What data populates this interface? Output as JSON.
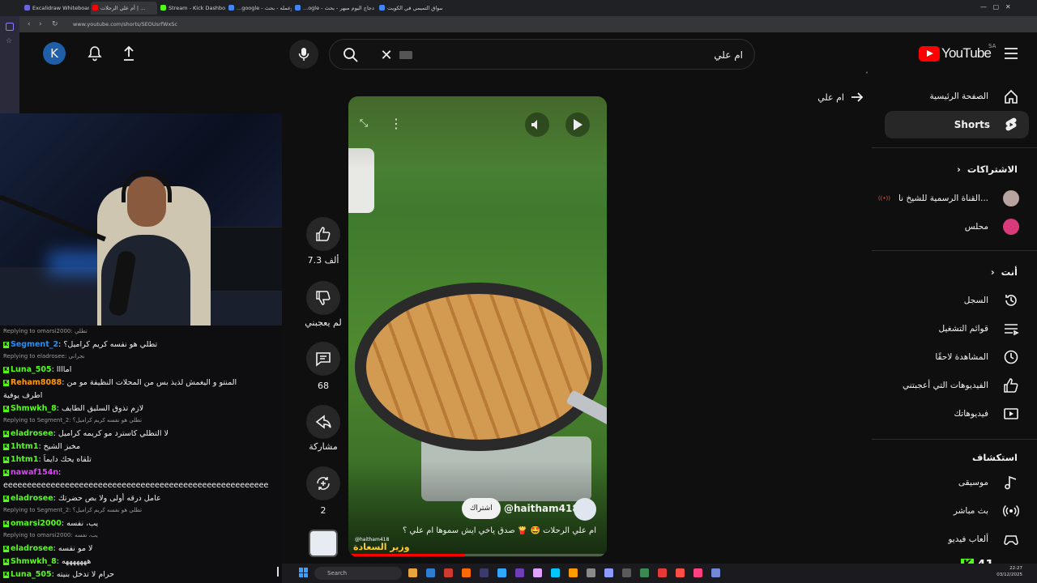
{
  "browser": {
    "tabs": [
      {
        "label": "Excalidraw Whiteboard",
        "color": "#6965db"
      },
      {
        "label": "أم علي الرحلات | ...",
        "color": "#ff0000"
      },
      {
        "label": "Stream - Kick Dashboard",
        "color": "#53fc18"
      },
      {
        "label": "...google - معلم وعمله - بحث",
        "color": "#4285f4"
      },
      {
        "label": "...ogle - دجاج اليوم مبهر - بحث",
        "color": "#4285f4"
      },
      {
        "label": "اسواق التميمي في الكويت",
        "color": "#4285f4"
      }
    ],
    "url": "www.youtube.com/shorts/SEOUsrfWxSc"
  },
  "chat": {
    "messages": [
      {
        "type": "reply",
        "text": "Replying to omarsi2000: تطلي"
      },
      {
        "type": "msg",
        "user": "Segment_2",
        "color": "#1e90ff",
        "text": "تطلي هو نفسه كريم كراميل؟"
      },
      {
        "type": "reply",
        "text": "Replying to eladrosee: نجراني"
      },
      {
        "type": "msg",
        "user": "Luna_505",
        "color": "#53fc18",
        "text": "اماااا"
      },
      {
        "type": "msg",
        "user": "Reham8088",
        "color": "#ff9800",
        "text": "المنتو و اليغمش لذيذ بس من المحلات النظيفة مو من"
      },
      {
        "type": "cont",
        "text": "اطرف يوفية"
      },
      {
        "type": "msg",
        "user": "Shmwkh_8",
        "color": "#53fc18",
        "text": "لازم تذوق السليق الطايف"
      },
      {
        "type": "reply",
        "text": "Replying to Segment_2: تطلي هو نفسه كريم كراميل؟"
      },
      {
        "type": "msg",
        "user": "eladrosee",
        "color": "#53fc18",
        "text": "لا التطلي كاسترد مو كريمه كراميل"
      },
      {
        "type": "msg",
        "user": "1htm1",
        "color": "#53fc18",
        "text": "مخبز الشيخ"
      },
      {
        "type": "msg",
        "user": "1htm1",
        "color": "#53fc18",
        "text": "تلقاه يحك دايماً"
      },
      {
        "type": "msg",
        "user": "nawaf154n",
        "color": "#e040fb",
        "text": ""
      },
      {
        "type": "cont",
        "text": "eeeeeeeeeeeeeeeeeeeeeeeeeeeeeeeeeeeeeeeeeeeeeeeeeeeeeeee"
      },
      {
        "type": "msg",
        "user": "eladrosee",
        "color": "#53fc18",
        "text": "عامل درقه أولى ولا بص حضرتك"
      },
      {
        "type": "reply",
        "text": "Replying to Segment_2: تطلي هو نفسه كريم كراميل؟"
      },
      {
        "type": "msg",
        "user": "omarsi2000",
        "color": "#53fc18",
        "text": "يب، نفسه"
      },
      {
        "type": "reply",
        "text": "Replying to omarsi2000: يب، نفسه"
      },
      {
        "type": "msg",
        "user": "eladrosee",
        "color": "#53fc18",
        "text": "لا مو نفسه"
      },
      {
        "type": "msg",
        "user": "Shmwkh_8",
        "color": "#53fc18",
        "text": "هههههههه"
      },
      {
        "type": "msg",
        "user": "Luna_505",
        "color": "#53fc18",
        "text": "حرام لا تدخل بنيته"
      }
    ]
  },
  "header": {
    "avatar_letter": "K",
    "search_value": "ام علي",
    "logo_text": "YouTube",
    "region": "SA"
  },
  "shorts": {
    "back_label": "ام علي",
    "channel": "@haitham418",
    "subscribe": "اشتراك",
    "title": "ام علي الرحلات 🤩 🍟 صدق ياخي ايش سموها ام علي ؟",
    "watermark_top": "@haitham418",
    "watermark_bottom": "وزير السعادة",
    "likes": "7.3 ألف",
    "dislike": "لم يعجبني",
    "comments": "68",
    "share": "مشاركة",
    "remix": "2",
    "progress": 0.45
  },
  "sidebar": {
    "main": [
      {
        "label": "الصفحة الرئيسية",
        "icon": "home-icon"
      },
      {
        "label": "Shorts",
        "icon": "shorts-icon"
      }
    ],
    "subs_title": "الاشتراكات",
    "subs": [
      {
        "label": "القناة الرسمية للشيخ نا...",
        "live": true
      },
      {
        "label": "محلس",
        "live": false
      }
    ],
    "you_title": "أنت",
    "you": [
      {
        "label": "السجل",
        "icon": "history-icon"
      },
      {
        "label": "قوائم التشغيل",
        "icon": "playlist-icon"
      },
      {
        "label": "المشاهدة لاحقًا",
        "icon": "clock-icon"
      },
      {
        "label": "الفيديوهات التي أعجبتني",
        "icon": "thumbs-up-icon"
      },
      {
        "label": "فيديوهاتك",
        "icon": "video-icon"
      }
    ],
    "explore_title": "استكشاف",
    "explore": [
      {
        "label": "موسيقى",
        "icon": "music-icon"
      },
      {
        "label": "بث مباشر",
        "icon": "live-icon"
      },
      {
        "label": "ألعاب فيديو",
        "icon": "gamepad-icon"
      }
    ]
  },
  "overlay": {
    "viewer_count": "41"
  },
  "taskbar": {
    "search": "Search",
    "time": "22:27",
    "date": "03/12/2025"
  }
}
